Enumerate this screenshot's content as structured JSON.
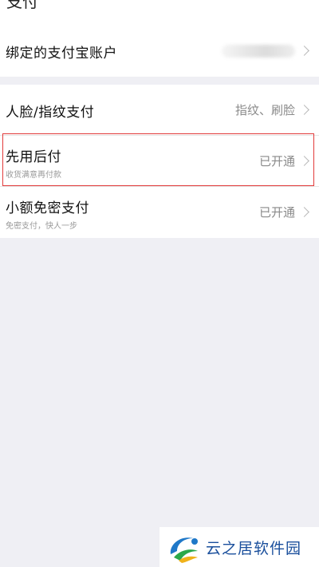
{
  "header": {
    "cut_title": "支付"
  },
  "account_group": {
    "bound_account_label": "绑定的支付宝账户"
  },
  "settings_group": {
    "items": [
      {
        "title": "人脸/指纹支付",
        "subtitle": "",
        "value": "指纹、刷脸"
      },
      {
        "title": "先用后付",
        "subtitle": "收货满意再付款",
        "value": "已开通"
      },
      {
        "title": "小额免密支付",
        "subtitle": "免密支付，快人一步",
        "value": "已开通"
      }
    ]
  },
  "watermark": {
    "text": "云之居软件园",
    "icon": "yunzhiju-logo-icon"
  },
  "colors": {
    "page_bg": "#efeff4",
    "highlight_border": "#e23b3b",
    "watermark_text": "#1a4f9c"
  }
}
